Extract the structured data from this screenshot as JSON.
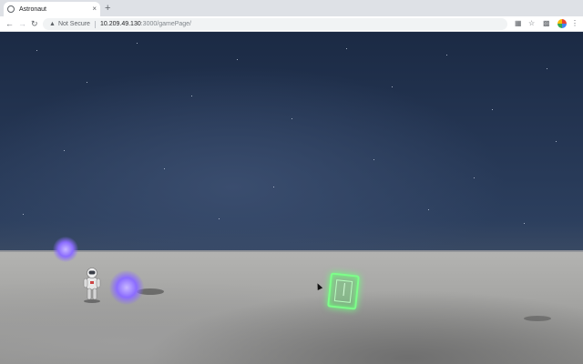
{
  "browser": {
    "tab_title": "Astronaut",
    "tab_close": "×",
    "new_tab": "+",
    "security_label": "Not Secure",
    "url_host": "10.209.49.130",
    "url_path": ":3000/gamePage/",
    "icons": [
      "back-icon",
      "forward-icon",
      "reload-icon",
      "warning-icon",
      "translate-icon",
      "star-icon",
      "puzzle-icon",
      "profile-avatar-icon",
      "more-icon"
    ]
  },
  "game": {
    "scene": "moon-surface",
    "colors": {
      "portal": "#7dff8a",
      "orb": "#8b6cff",
      "sky": "#1b2a44"
    },
    "objects": [
      "astronaut",
      "energy-orb",
      "energy-orb",
      "green-portal"
    ]
  }
}
